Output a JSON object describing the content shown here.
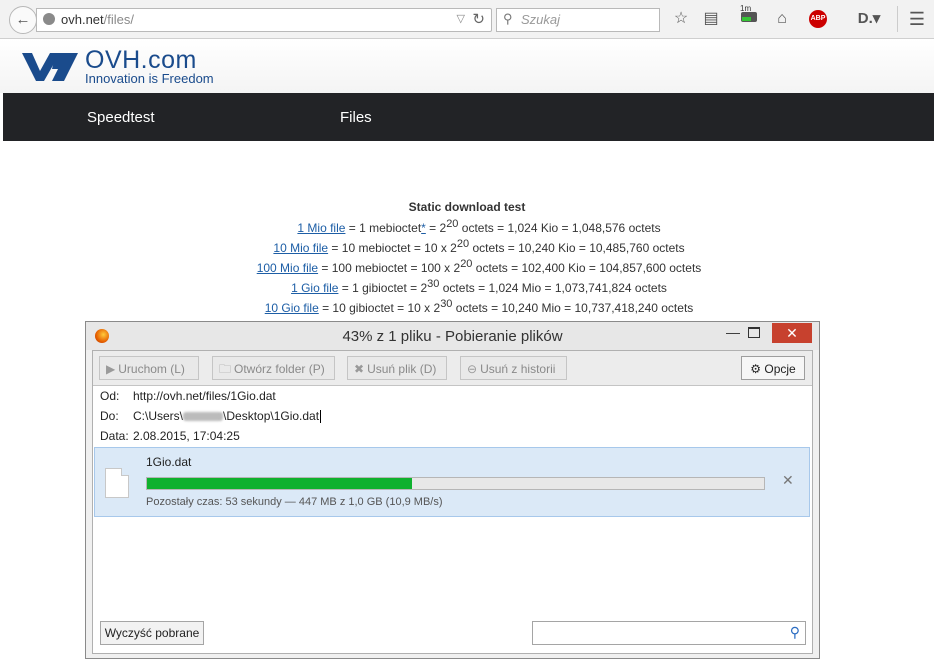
{
  "browser": {
    "url_host": "ovh.net",
    "url_path": "/files/",
    "search_placeholder": "Szukaj",
    "dash_label": "1m"
  },
  "site": {
    "logo_text": "OVH.com",
    "tagline": "Innovation is Freedom",
    "nav": [
      "Speedtest",
      "Files"
    ]
  },
  "content": {
    "title": "Static download test",
    "lines": [
      {
        "link": "1 Mio file",
        "pre": " = 1 mebioctet",
        "star": "*",
        "mid": " = 2",
        "exp": "20",
        "post": " octets = 1,024 Kio = 1,048,576 octets"
      },
      {
        "link": "10 Mio file",
        "pre": " = 10 mebioctet",
        "star": "",
        "mid": " = 10 x 2",
        "exp": "20",
        "post": " octets = 10,240 Kio = 10,485,760 octets"
      },
      {
        "link": "100 Mio file",
        "pre": " = 100 mebioctet",
        "star": "",
        "mid": " = 100 x 2",
        "exp": "20",
        "post": " octets = 102,400 Kio = 104,857,600 octets"
      },
      {
        "link": "1 Gio file",
        "pre": " = 1 gibioctet",
        "star": "",
        "mid": " = 2",
        "exp": "30",
        "post": " octets = 1,024 Mio = 1,073,741,824 octets"
      },
      {
        "link": "10 Gio file",
        "pre": " = 10 gibioctet",
        "star": "",
        "mid": " = 10 x 2",
        "exp": "30",
        "post": " octets = 10,240 Mio = 10,737,418,240 octets"
      }
    ]
  },
  "download_window": {
    "title": "43% z 1 pliku - Pobieranie plików",
    "toolbar": {
      "run": "Uruchom (L)",
      "open_folder": "Otwórz folder (P)",
      "delete_file": "Usuń plik (D)",
      "remove_history": "Usuń z historii",
      "options": "Opcje"
    },
    "info": {
      "from_label": "Od:",
      "from_value": "http://ovh.net/files/1Gio.dat",
      "to_label": "Do:",
      "to_prefix": "C:\\Users\\",
      "to_suffix": "\\Desktop\\1Gio.dat",
      "date_label": "Data:",
      "date_value": "2.08.2015, 17:04:25"
    },
    "item": {
      "filename": "1Gio.dat",
      "progress": 0.43,
      "status": "Pozostały czas: 53 sekundy — 447 MB z 1,0 GB (10,9 MB/s)"
    },
    "clear_button": "Wyczyść pobrane"
  },
  "colors": {
    "nav_bg": "#222326",
    "brand": "#1a4b8c",
    "progress": "#0fb12e",
    "close": "#c7412e"
  }
}
